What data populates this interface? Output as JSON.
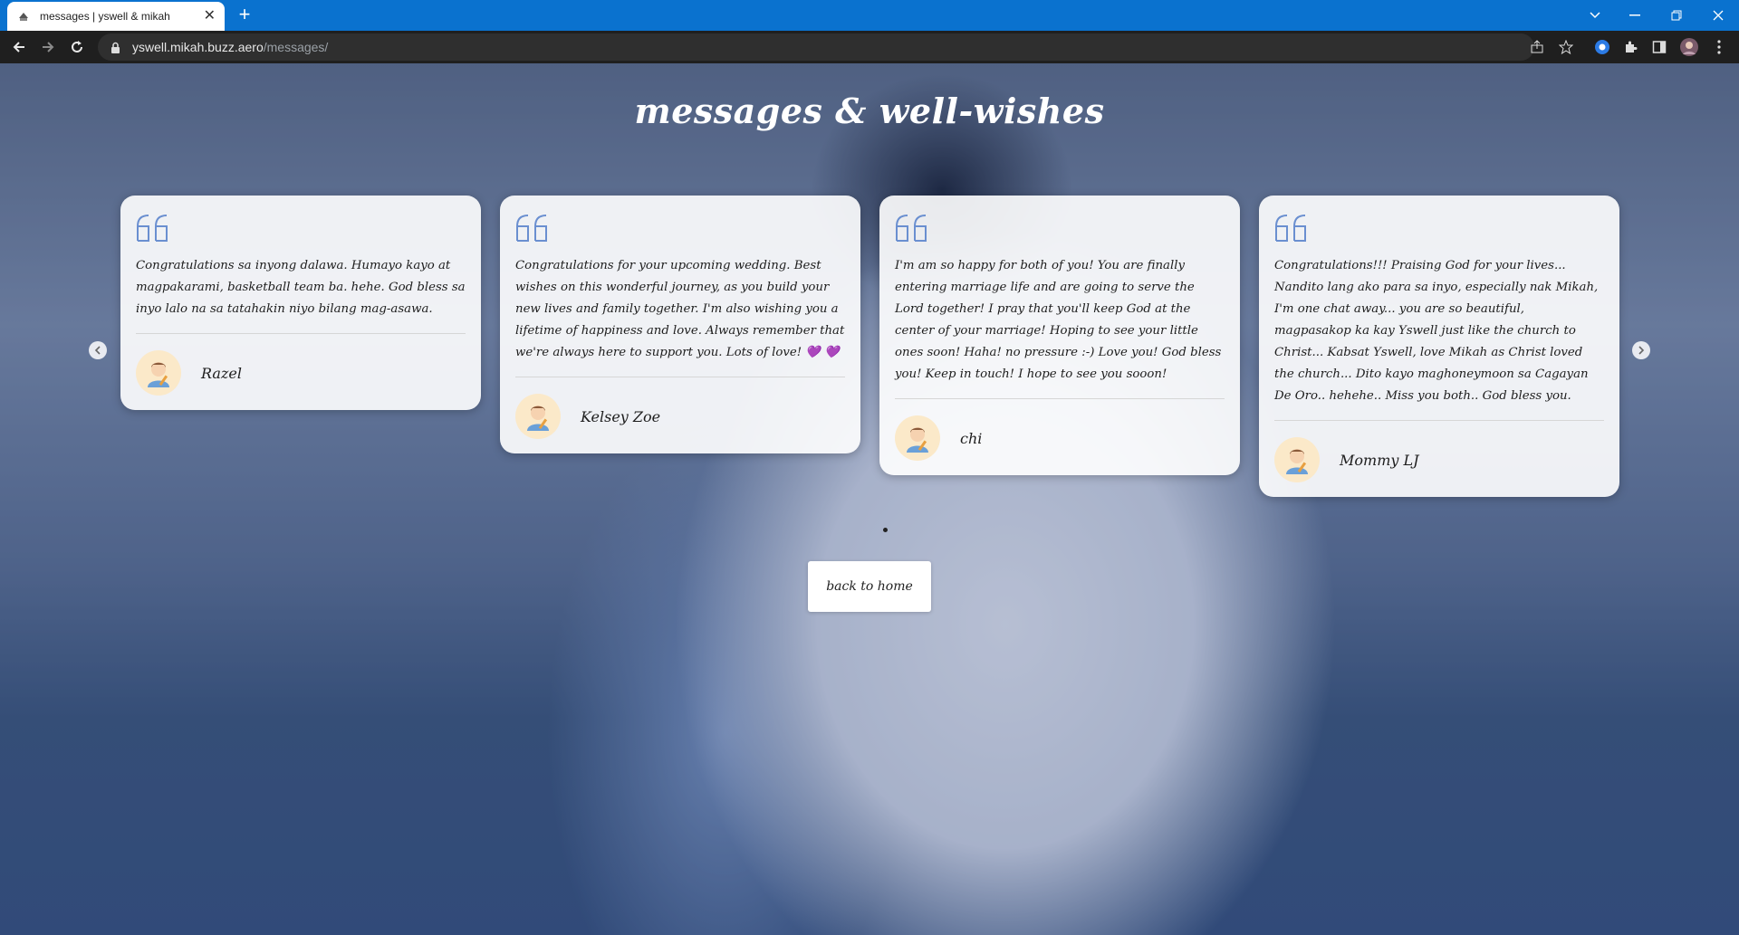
{
  "browser": {
    "tab_title": "messages | yswell & mikah",
    "url_host": "yswell.mikah.buzz.aero",
    "url_path": "/messages/"
  },
  "page": {
    "heading": "messages & well-wishes",
    "back_button": "back to home"
  },
  "messages": [
    {
      "text": "Congratulations sa inyong dalawa. Humayo kayo at magpakarami, basketball team ba. hehe. God bless sa inyo lalo na sa tatahakin niyo bilang mag-asawa.",
      "author": "Razel"
    },
    {
      "text": "Congratulations for your upcoming wedding. Best wishes on this wonderful journey, as you build your new lives and family together. I'm also wishing you a lifetime of happiness and love. Always remember that we're always here to support you. Lots of love! ",
      "hearts": "💜 💜",
      "author": "Kelsey Zoe"
    },
    {
      "text": "I'm am so happy for both of you! You are finally entering marriage life and are going to serve the Lord together! I pray that you'll keep God at the center of your marriage! Hoping to see your little ones soon! Haha! no pressure :-) Love you! God bless you! Keep in touch! I hope to see you sooon!",
      "author": "chi"
    },
    {
      "text": "Congratulations!!! Praising God for your lives... Nandito lang ako para sa inyo, especially nak Mikah, I'm one chat away... you are so beautiful, magpasakop ka kay Yswell just like the church to Christ... Kabsat Yswell, love Mikah as Christ loved the church... Dito kayo maghoneymoon sa Cagayan De Oro.. hehehe.. Miss you both.. God bless you.",
      "author": "Mommy LJ"
    }
  ],
  "colors": {
    "tabbar": "#0a72cf",
    "toolbar": "#1f1f1f",
    "quote_mark": "#6a8fd0",
    "heart": "#8a4fd6"
  },
  "icons": [
    "favicon-icon",
    "close-icon",
    "plus-icon",
    "back-arrow-icon",
    "forward-arrow-icon",
    "reload-icon",
    "lock-icon",
    "share-icon",
    "star-icon",
    "extension-icon",
    "puzzle-icon",
    "sidebar-icon",
    "profile-icon",
    "menu-icon",
    "chevron-left-icon",
    "chevron-right-icon",
    "quote-icon",
    "avatar-icon"
  ]
}
